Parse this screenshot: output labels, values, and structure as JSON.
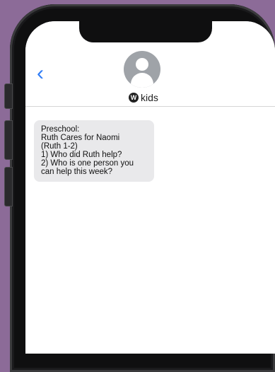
{
  "header": {
    "back_icon": "chevron-left-icon",
    "avatar_icon": "person-icon",
    "contact_logo": "W",
    "contact_name": "kids"
  },
  "messages": [
    {
      "from": "contact",
      "lines": [
        "Preschool:",
        "Ruth Cares for Naomi",
        "(Ruth 1-2)",
        "1) Who did Ruth help?",
        "2) Who is one person you",
        "can help this week?"
      ]
    }
  ],
  "colors": {
    "background": "#8c6b98",
    "accent": "#2f7cf6",
    "bubble": "#e9e9eb"
  }
}
